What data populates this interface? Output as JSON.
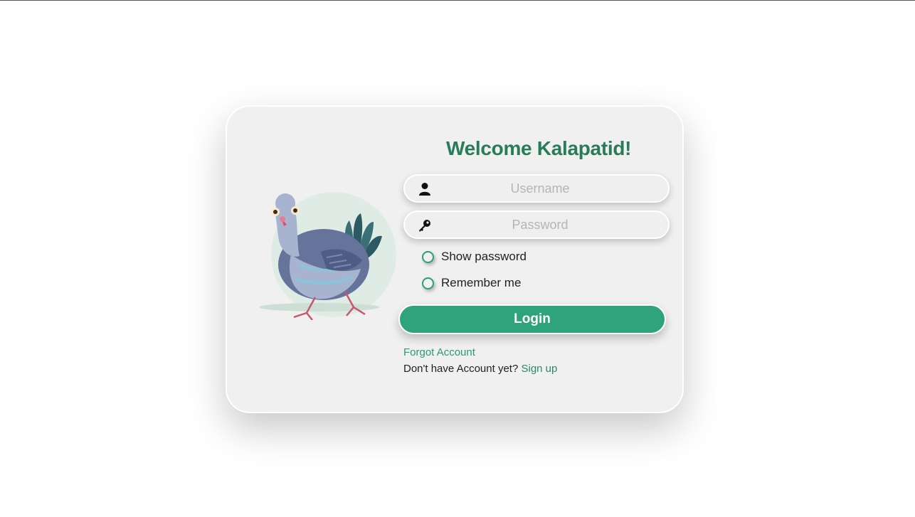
{
  "login": {
    "title": "Welcome Kalapatid!",
    "username_placeholder": "Username",
    "password_placeholder": "Password",
    "show_password_label": "Show password",
    "remember_me_label": "Remember me",
    "login_label": "Login",
    "forgot_label": "Forgot Account",
    "no_account_text": "Don't have Account yet?",
    "signup_label": "Sign up"
  },
  "icons": {
    "username": "user-icon",
    "password": "key-icon",
    "illustration": "pigeon-illustration"
  },
  "colors": {
    "accent": "#2ea37c",
    "title": "#2a7b58",
    "link": "#2a9a70",
    "card": "#f0f0f0"
  }
}
